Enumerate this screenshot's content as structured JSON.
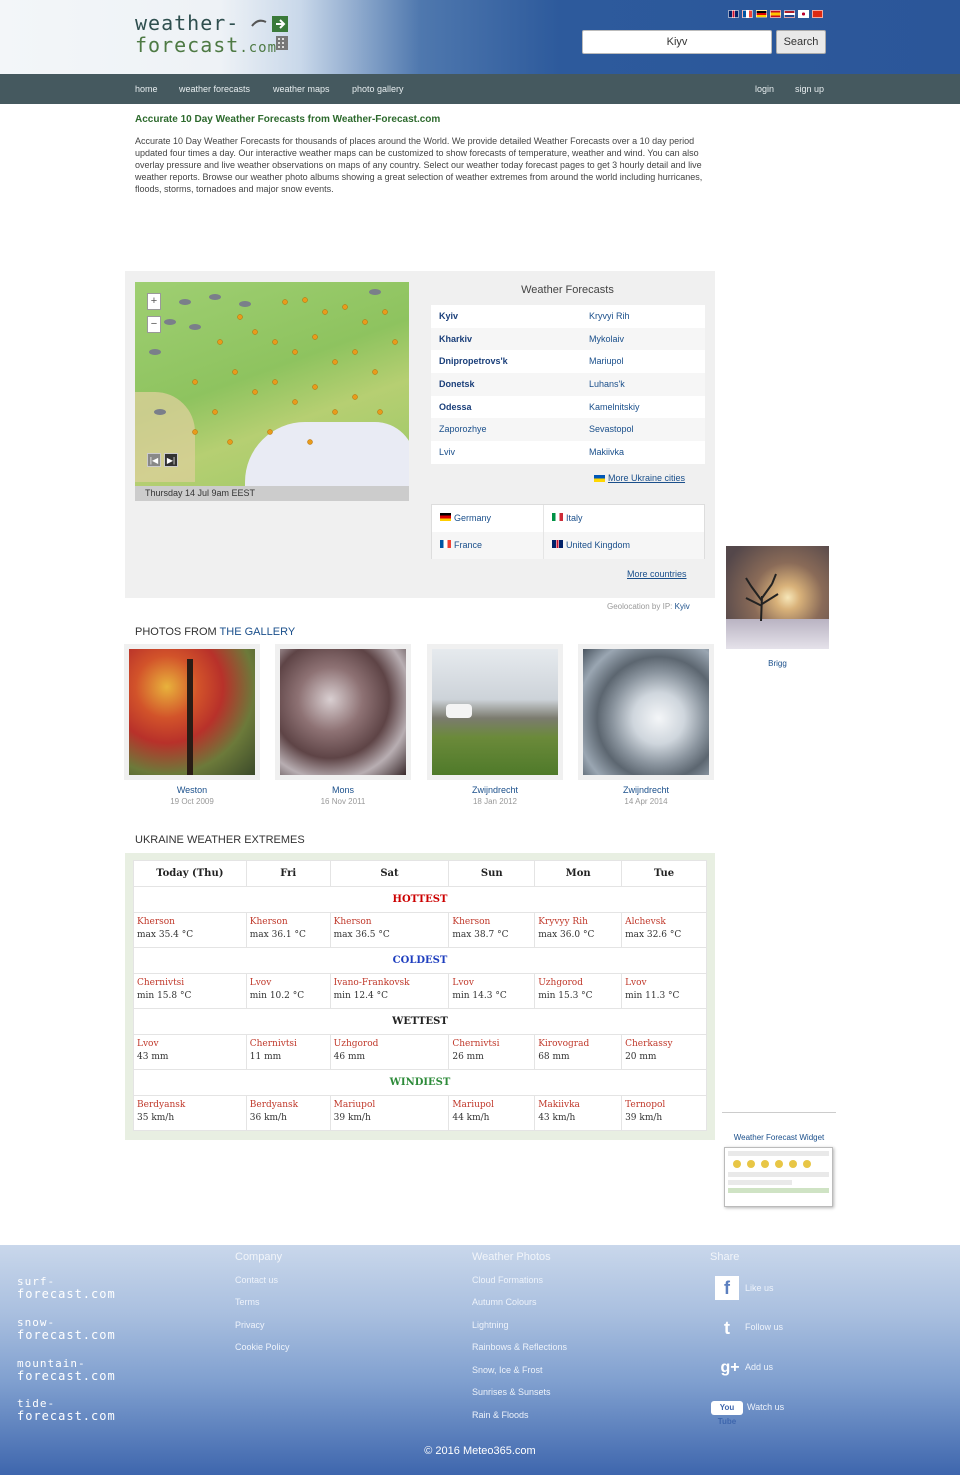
{
  "header": {
    "logo_line1": "weather-",
    "logo_line2": "forecast",
    "logo_suffix": ".com",
    "search_value": "Kiyv",
    "search_button": "Search",
    "flags": [
      "gb",
      "fr",
      "de",
      "es",
      "nl",
      "jp",
      "cn"
    ]
  },
  "nav": {
    "items": [
      "home",
      "weather forecasts",
      "weather maps",
      "photo gallery"
    ],
    "login": "login",
    "signup": "sign up"
  },
  "intro": {
    "title": "Accurate 10 Day Weather Forecasts from Weather-Forecast.com",
    "text": "Accurate 10 Day Weather Forecasts for thousands of places around the World. We provide detailed Weather Forecasts over a 10 day period updated four times a day. Our interactive weather maps can be customized to show forecasts of temperature, weather and wind. You can also overlay pressure and live weather observations on maps of any country. Select our weather today forecast pages to get 3 hourly detail and live weather reports. Browse our weather photo albums showing a great selection of weather extremes from around the world including hurricanes, floods, storms, tornadoes and major snow events."
  },
  "map": {
    "zoom_in": "+",
    "zoom_out": "−",
    "caption": "Thursday 14 Jul 9am EEST"
  },
  "forecasts": {
    "title": "Weather Forecasts",
    "rows": [
      [
        "Kyiv",
        "Kryvyi Rih"
      ],
      [
        "Kharkiv",
        "Mykolaiv"
      ],
      [
        "Dnipropetrovs'k",
        "Mariupol"
      ],
      [
        "Donetsk",
        "Luhans'k"
      ],
      [
        "Odessa",
        "Kamelnitskiy"
      ],
      [
        "Zaporozhye",
        "Sevastopol"
      ],
      [
        "Lviv",
        "Makiivka"
      ]
    ],
    "more_cities": "More Ukraine cities",
    "countries": [
      [
        "Germany",
        "Italy"
      ],
      [
        "France",
        "United Kingdom"
      ]
    ],
    "more_countries": "More countries",
    "geo_label": "Geolocation by IP:",
    "geo_city": "Kyiv"
  },
  "side_photo": {
    "caption": "Brigg"
  },
  "gallery": {
    "heading_a": "PHOTOS FROM ",
    "heading_b": "THE GALLERY",
    "items": [
      {
        "name": "Weston",
        "date": "19 Oct 2009"
      },
      {
        "name": "Mons",
        "date": "16 Nov 2011"
      },
      {
        "name": "Zwijndrecht",
        "date": "18 Jan 2012"
      },
      {
        "name": "Zwijndrecht",
        "date": "14 Apr 2014"
      }
    ]
  },
  "extremes": {
    "heading": "UKRAINE WEATHER EXTREMES",
    "days": [
      "Today (Thu)",
      "Fri",
      "Sat",
      "Sun",
      "Mon",
      "Tue"
    ],
    "categories": [
      {
        "label": "HOTTEST",
        "color": "#cc0000",
        "cells": [
          [
            "Kherson",
            "max 35.4 °C"
          ],
          [
            "Kherson",
            "max 36.1 °C"
          ],
          [
            "Kherson",
            "max 36.5 °C"
          ],
          [
            "Kherson",
            "max 38.7 °C"
          ],
          [
            "Kryvyy Rih",
            "max 36.0 °C"
          ],
          [
            "Alchevsk",
            "max 32.6 °C"
          ]
        ]
      },
      {
        "label": "COLDEST",
        "color": "#1f3fbf",
        "cells": [
          [
            "Chernivtsi",
            "min 15.8 °C"
          ],
          [
            "Lvov",
            "min 10.2 °C"
          ],
          [
            "Ivano-Frankovsk",
            "min 12.4 °C"
          ],
          [
            "Lvov",
            "min 14.3 °C"
          ],
          [
            "Uzhgorod",
            "min 15.3 °C"
          ],
          [
            "Lvov",
            "min 11.3 °C"
          ]
        ]
      },
      {
        "label": "WETTEST",
        "color": "#222222",
        "cells": [
          [
            "Lvov",
            "43 mm"
          ],
          [
            "Chernivtsi",
            "11 mm"
          ],
          [
            "Uzhgorod",
            "46 mm"
          ],
          [
            "Chernivtsi",
            "26 mm"
          ],
          [
            "Kirovograd",
            "68 mm"
          ],
          [
            "Cherkassy",
            "20 mm"
          ]
        ]
      },
      {
        "label": "WINDIEST",
        "color": "#2e8b3a",
        "cells": [
          [
            "Berdyansk",
            "35 km/h"
          ],
          [
            "Berdyansk",
            "36 km/h"
          ],
          [
            "Mariupol",
            "39 km/h"
          ],
          [
            "Mariupol",
            "44 km/h"
          ],
          [
            "Makiivka",
            "43 km/h"
          ],
          [
            "Ternopol",
            "39 km/h"
          ]
        ]
      }
    ]
  },
  "widget": {
    "title": "Weather Forecast Widget"
  },
  "footer": {
    "sites": [
      {
        "top": "surf-",
        "bottom": "forecast",
        "suffix": ".com"
      },
      {
        "top": "snow-",
        "bottom": "forecast",
        "suffix": ".com"
      },
      {
        "top": "mountain-",
        "bottom": "forecast",
        "suffix": ".com"
      },
      {
        "top": "tide-",
        "bottom": "forecast",
        "suffix": ".com"
      }
    ],
    "company_heading": "Company",
    "company_links": [
      "Contact us",
      "Terms",
      "Privacy",
      "Cookie Policy"
    ],
    "photos_heading": "Weather Photos",
    "photos_links": [
      "Cloud Formations",
      "Autumn Colours",
      "Lightning",
      "Rainbows & Reflections",
      "Snow, Ice & Frost",
      "Sunrises & Sunsets",
      "Rain & Floods"
    ],
    "share_heading": "Share",
    "share": [
      {
        "icon": "f",
        "label": "Like us"
      },
      {
        "icon": "t",
        "label": "Follow us"
      },
      {
        "icon": "g+",
        "label": "Add us"
      },
      {
        "icon": "You Tube",
        "label": "Watch us"
      }
    ],
    "copyright": "© 2016 Meteo365.com"
  }
}
